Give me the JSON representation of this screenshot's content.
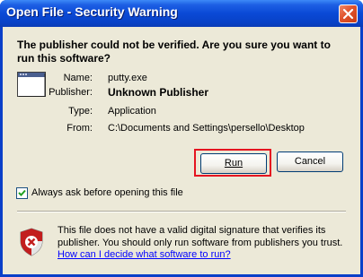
{
  "window": {
    "title": "Open File - Security Warning"
  },
  "header": {
    "question_line1": "The publisher could not be verified.  Are you sure you want to",
    "question_line2": "run this software?"
  },
  "details": [
    {
      "label": "Name:",
      "value": "putty.exe"
    },
    {
      "label": "Publisher:",
      "value": "Unknown Publisher"
    },
    {
      "label": "Type:",
      "value": "Application"
    },
    {
      "label": "From:",
      "value": "C:\\Documents and Settings\\persello\\Desktop"
    }
  ],
  "buttons": {
    "run_label": "Run",
    "cancel_label": "Cancel"
  },
  "checkbox": {
    "label": "Always ask before opening this file",
    "checked": true
  },
  "info": {
    "line1": "This file does not have a valid digital signature that verifies its",
    "line2": "publisher.  You should only run software from publishers you trust.",
    "link_text": "How can I decide what software to run?"
  },
  "icons": {
    "app": "application-window-icon",
    "shield": "security-shield-icon",
    "close": "close-icon"
  },
  "colors": {
    "titlebar": "#0a49d6",
    "dialog_bg": "#ece9d8",
    "highlight_frame": "#e51420",
    "link": "#0000ff"
  }
}
